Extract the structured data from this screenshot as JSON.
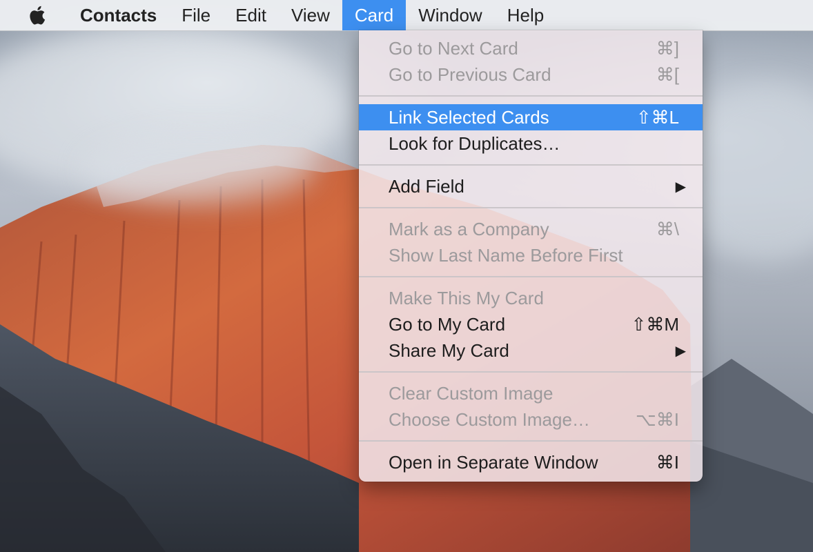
{
  "menubar": {
    "apple_icon": "apple-icon",
    "app_name": "Contacts",
    "items": [
      "File",
      "Edit",
      "View",
      "Card",
      "Window",
      "Help"
    ],
    "active_item": "Card"
  },
  "card_menu": {
    "highlight_color": "#3d8ff0",
    "group1": {
      "next_card": {
        "label": "Go to Next Card",
        "shortcut": "⌘]"
      },
      "previous_card": {
        "label": "Go to Previous Card",
        "shortcut": "⌘["
      }
    },
    "group2": {
      "link_selected": {
        "label": "Link Selected Cards",
        "shortcut": "⇧⌘L"
      },
      "look_for_duplicates": {
        "label": "Look for Duplicates…"
      }
    },
    "group3": {
      "add_field": {
        "label": "Add Field",
        "arrow": "▶"
      }
    },
    "group4": {
      "mark_company": {
        "label": "Mark as a Company",
        "shortcut": "⌘\\"
      },
      "last_name_first": {
        "label": "Show Last Name Before First"
      }
    },
    "group5": {
      "make_my_card": {
        "label": "Make This My Card"
      },
      "go_to_my_card": {
        "label": "Go to My Card",
        "shortcut": "⇧⌘M"
      },
      "share_my_card": {
        "label": "Share My Card",
        "arrow": "▶"
      }
    },
    "group6": {
      "clear_image": {
        "label": "Clear Custom Image"
      },
      "choose_image": {
        "label": "Choose Custom Image…",
        "shortcut": "⌥⌘I"
      }
    },
    "group7": {
      "open_separate": {
        "label": "Open in Separate Window",
        "shortcut": "⌘I"
      }
    }
  }
}
